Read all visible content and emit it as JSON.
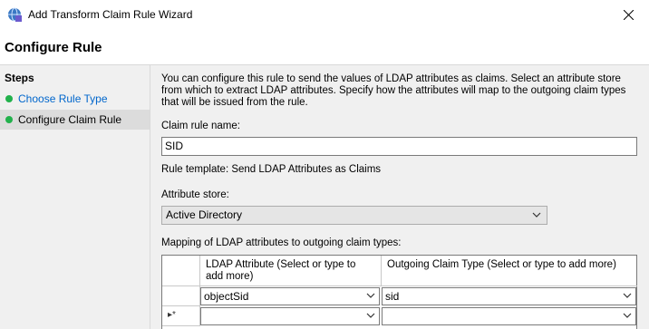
{
  "window": {
    "title": "Add Transform Claim Rule Wizard",
    "close_icon": "close-icon"
  },
  "header": {
    "title": "Configure Rule"
  },
  "steps": {
    "heading": "Steps",
    "items": [
      {
        "label": "Choose Rule Type",
        "state": "link"
      },
      {
        "label": "Configure Claim Rule",
        "state": "current"
      }
    ]
  },
  "main": {
    "intro": "You can configure this rule to send the values of LDAP attributes as claims. Select an attribute store from which to extract LDAP attributes. Specify how the attributes will map to the outgoing claim types that will be issued from the rule.",
    "claim_rule_name_label": "Claim rule name:",
    "claim_rule_name_value": "SID",
    "rule_template": "Rule template: Send LDAP Attributes as Claims",
    "attribute_store_label": "Attribute store:",
    "attribute_store_value": "Active Directory",
    "mapping_label": "Mapping of LDAP attributes to outgoing claim types:",
    "grid": {
      "columns": [
        "LDAP Attribute (Select or type to add more)",
        "Outgoing Claim Type (Select or type to add more)"
      ],
      "rows": [
        {
          "ldap": "objectSid",
          "claim": "sid"
        },
        {
          "ldap": "",
          "claim": ""
        }
      ],
      "new_row_marker": "▸*"
    }
  },
  "colors": {
    "accent": "#0066cc",
    "step_dot": "#22b14c"
  }
}
